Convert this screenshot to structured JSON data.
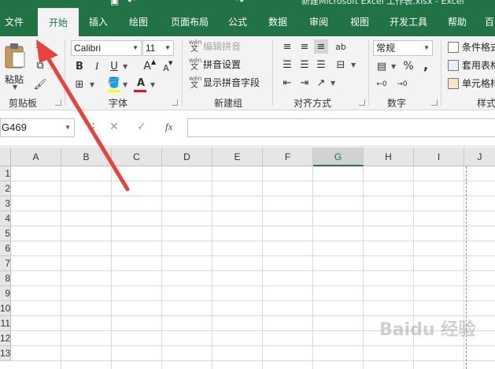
{
  "window": {
    "title": "新建Microsoft Excel 工作表.xlsx - Excel"
  },
  "tabs": [
    {
      "label": "文件",
      "active": false
    },
    {
      "label": "开始",
      "active": true
    },
    {
      "label": "插入",
      "active": false
    },
    {
      "label": "绘图",
      "active": false
    },
    {
      "label": "页面布局",
      "active": false
    },
    {
      "label": "公式",
      "active": false
    },
    {
      "label": "数据",
      "active": false
    },
    {
      "label": "审阅",
      "active": false
    },
    {
      "label": "视图",
      "active": false
    },
    {
      "label": "开发工具",
      "active": false
    },
    {
      "label": "帮助",
      "active": false
    },
    {
      "label": "百",
      "active": false
    }
  ],
  "clipboard": {
    "paste_label": "粘贴",
    "group_label": "剪贴板"
  },
  "font": {
    "name": "Calibri",
    "size": "11",
    "bold": "B",
    "italic": "I",
    "underline": "U",
    "grow": "A",
    "shrink": "A",
    "color_glyph": "A",
    "group_label": "字体"
  },
  "pinyin": {
    "edit_label": "编辑拼音",
    "settings_label": "拼音设置",
    "show_label": "显示拼音字段",
    "wen": "wén",
    "wen_char": "文",
    "group_label": "新建组"
  },
  "alignment": {
    "group_label": "对齐方式"
  },
  "number": {
    "format": "常规",
    "percent": "%",
    "comma": ",",
    "group_label": "数字"
  },
  "styles": {
    "conditional_label": "条件格式",
    "table_label": "套用表格",
    "cell_label": "单元格样",
    "group_label": "样式"
  },
  "formula_bar": {
    "name_box": "G469",
    "fx": "fx",
    "cancel": "✕",
    "enter": "✓",
    "formula": ""
  },
  "grid": {
    "columns": [
      "A",
      "B",
      "C",
      "D",
      "E",
      "F",
      "G",
      "H",
      "I",
      "J"
    ],
    "selected_column": "G",
    "rows": [
      "1",
      "2",
      "3",
      "4",
      "5",
      "6",
      "7",
      "8",
      "9",
      "10",
      "11",
      "12",
      "13"
    ]
  },
  "watermark": "Baidu 经验",
  "colors": {
    "excel_green": "#217346",
    "arrow_red": "#e8423b",
    "font_color_bar": "#e81123",
    "highlight_bar": "#ffff00"
  }
}
